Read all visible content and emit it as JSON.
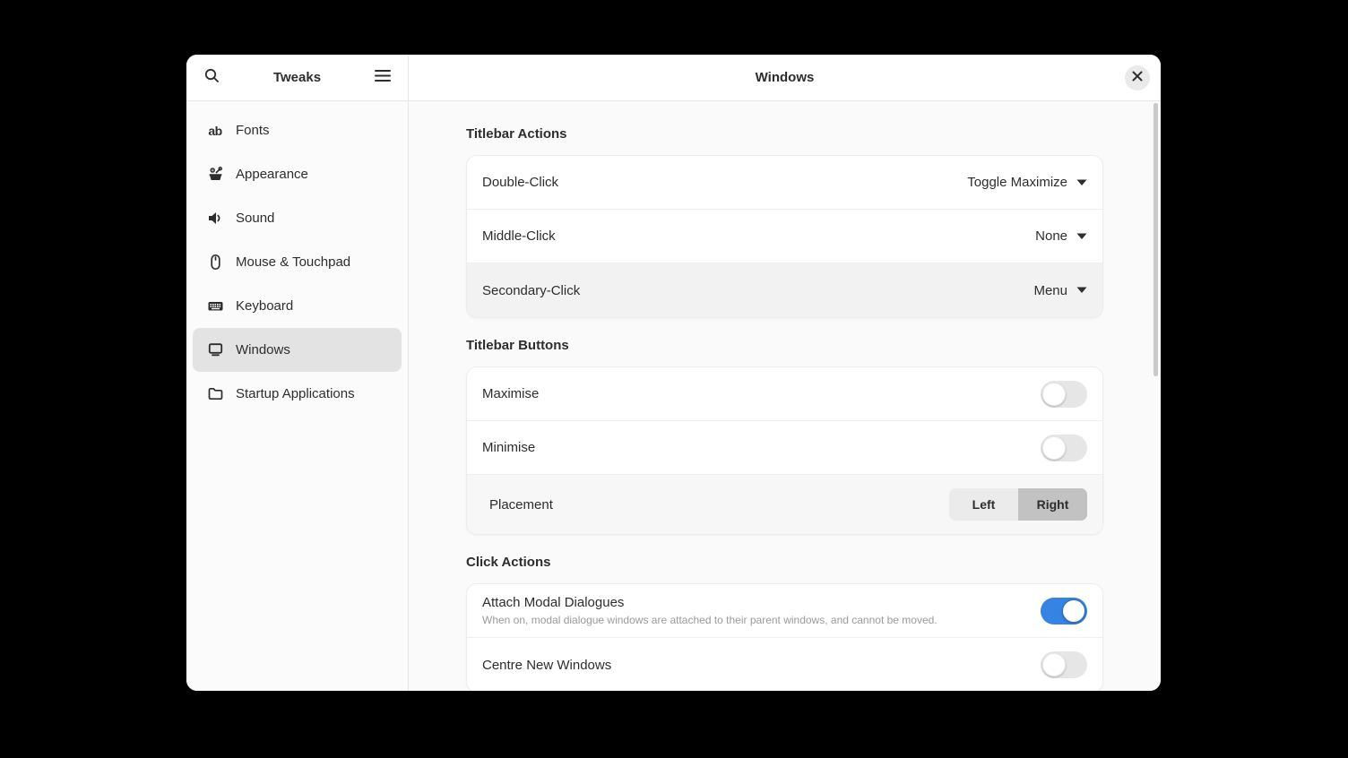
{
  "app": {
    "sidebar_title": "Tweaks",
    "header_title": "Windows"
  },
  "sidebar": {
    "items": [
      {
        "label": "Fonts",
        "icon": "fonts-icon",
        "selected": false
      },
      {
        "label": "Appearance",
        "icon": "appearance-icon",
        "selected": false
      },
      {
        "label": "Sound",
        "icon": "sound-icon",
        "selected": false
      },
      {
        "label": "Mouse & Touchpad",
        "icon": "mouse-icon",
        "selected": false
      },
      {
        "label": "Keyboard",
        "icon": "keyboard-icon",
        "selected": false
      },
      {
        "label": "Windows",
        "icon": "windows-icon",
        "selected": true
      },
      {
        "label": "Startup Applications",
        "icon": "startup-icon",
        "selected": false
      }
    ]
  },
  "sections": [
    {
      "title": "Titlebar Actions",
      "rows": [
        {
          "label": "Double-Click",
          "control": "dropdown",
          "value": "Toggle Maximize"
        },
        {
          "label": "Middle-Click",
          "control": "dropdown",
          "value": "None"
        },
        {
          "label": "Secondary-Click",
          "control": "dropdown",
          "value": "Menu"
        }
      ]
    },
    {
      "title": "Titlebar Buttons",
      "rows": [
        {
          "label": "Maximise",
          "control": "toggle",
          "state": "off"
        },
        {
          "label": "Minimise",
          "control": "toggle",
          "state": "off"
        },
        {
          "label": "Placement",
          "control": "segmented",
          "options": [
            "Left",
            "Right"
          ],
          "selected": "Right"
        }
      ]
    },
    {
      "title": "Click Actions",
      "rows": [
        {
          "label": "Attach Modal Dialogues",
          "subtitle": "When on, modal dialogue windows are attached to their parent windows, and cannot be moved.",
          "control": "toggle",
          "state": "on"
        },
        {
          "label": "Centre New Windows",
          "control": "toggle",
          "state": "off"
        }
      ]
    }
  ],
  "colors": {
    "accent": "#3584e4",
    "toggle_off_track": "#e6e6e6",
    "segment_active": "#c2c2c2",
    "selected_sidebar_item": "#e3e3e3"
  }
}
